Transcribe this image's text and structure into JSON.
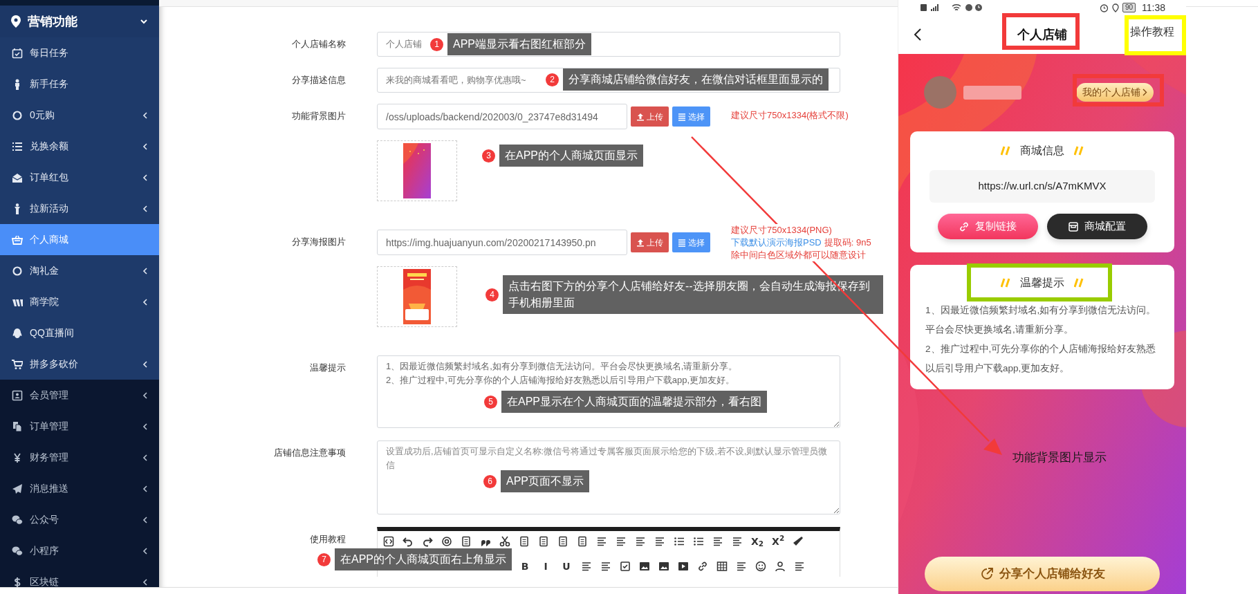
{
  "sidebar": {
    "header": {
      "label": "营销功能",
      "expanded": true
    },
    "items": [
      {
        "label": "每日任务",
        "nested": true,
        "has_submenu": false,
        "selected": false
      },
      {
        "label": "新手任务",
        "nested": true,
        "has_submenu": false,
        "selected": false
      },
      {
        "label": "0元购",
        "nested": true,
        "has_submenu": true,
        "selected": false
      },
      {
        "label": "兑换余额",
        "nested": true,
        "has_submenu": true,
        "selected": false
      },
      {
        "label": "订单红包",
        "nested": true,
        "has_submenu": true,
        "selected": false
      },
      {
        "label": "拉新活动",
        "nested": true,
        "has_submenu": true,
        "selected": false
      },
      {
        "label": "个人商城",
        "nested": true,
        "has_submenu": false,
        "selected": true
      },
      {
        "label": "淘礼金",
        "nested": true,
        "has_submenu": true,
        "selected": false
      },
      {
        "label": "商学院",
        "nested": true,
        "has_submenu": true,
        "selected": false
      },
      {
        "label": "QQ直播间",
        "nested": true,
        "has_submenu": false,
        "selected": false
      },
      {
        "label": "拼多多砍价",
        "nested": true,
        "has_submenu": true,
        "selected": false
      },
      {
        "label": "会员管理",
        "nested": false,
        "has_submenu": true,
        "selected": false
      },
      {
        "label": "订单管理",
        "nested": false,
        "has_submenu": true,
        "selected": false
      },
      {
        "label": "财务管理",
        "nested": false,
        "has_submenu": true,
        "selected": false
      },
      {
        "label": "消息推送",
        "nested": false,
        "has_submenu": true,
        "selected": false
      },
      {
        "label": "公众号",
        "nested": false,
        "has_submenu": true,
        "selected": false
      },
      {
        "label": "小程序",
        "nested": false,
        "has_submenu": true,
        "selected": false
      },
      {
        "label": "区块链",
        "nested": false,
        "has_submenu": true,
        "selected": false
      }
    ]
  },
  "form": {
    "rows": [
      {
        "kind": "input",
        "label": "个人店铺名称",
        "value": "个人店铺",
        "callout": {
          "number": "1",
          "text": "APP端显示看右图红框部分"
        }
      },
      {
        "kind": "input",
        "label": "分享描述信息",
        "value": "来我的商城看看吧，购物享优惠哦~",
        "callout": {
          "number": "2",
          "text": "分享商城店铺给微信好友，在微信对话框里面显示的"
        }
      },
      {
        "kind": "upload",
        "label": "功能背景图片",
        "value": "/oss/uploads/backend/202003/0_23747e8d31494",
        "buttons": [
          "上传",
          "选择"
        ],
        "hints": [
          {
            "kind": "warning",
            "text": "建议尺寸750x1334(格式不限)"
          }
        ],
        "callout": {
          "number": "3",
          "text": "在APP的个人商城页面显示"
        }
      },
      {
        "kind": "upload",
        "label": "分享海报图片",
        "value": "https://img.huajuanyun.com/20200217143950.pn",
        "buttons": [
          "上传",
          "选择"
        ],
        "hints": [
          {
            "kind": "warning",
            "text": "建议尺寸750x1334(PNG)"
          },
          {
            "kind": "link",
            "link": "下载默认演示海报PSD",
            "text": "提取码: 9n5"
          },
          {
            "kind": "warning",
            "text": "除中间白色区域外都可以随意设计"
          }
        ],
        "callout": {
          "number": "4",
          "text": "点击右图下方的分享个人店铺给好友--选择朋友圈，会自动生成海报保存到手机相册里面"
        }
      },
      {
        "kind": "textarea",
        "label": "温馨提示",
        "value": "1、因最近微信频繁封域名,如有分享到微信无法访问。平台会尽快更换域名,请重新分享。\n2、推广过程中,可先分享你的个人店铺海报给好友熟悉以后引导用户下载app,更加友好。",
        "callout": {
          "number": "5",
          "text": "在APP显示在个人商城页面的温馨提示部分，看右图"
        }
      },
      {
        "kind": "textarea",
        "label": "店铺信息注意事项",
        "placeholder": "设置成功后,店铺首页可显示自定义名称:微信号将通过专属客服页面展示给您的下级,若不设,则默认显示管理员微信",
        "callout": {
          "number": "6",
          "text": "APP页面不显示"
        }
      },
      {
        "kind": "editor",
        "label": "使用教程",
        "toolbar_texts": [
          [
            "X$_{2}$",
            "X$^{2}$"
          ],
          [
            "B",
            "I",
            "U"
          ]
        ],
        "callout": {
          "number": "7",
          "text": "在APP的个人商城页面右上角显示"
        }
      }
    ]
  },
  "phone": {
    "status": {
      "battery": "90",
      "time": "11:38"
    },
    "title": "个人店铺",
    "tutorial_link": "操作教程",
    "shop_button": "我的个人店铺",
    "info_card": {
      "title": "商城信息",
      "url": "https://w.url.cn/s/A7mKMVX",
      "buttons": [
        "复制链接",
        "商城配置"
      ]
    },
    "tips_card": {
      "title": "温馨提示",
      "lines": [
        "1、因最近微信频繁封域名,如有分享到微信无法访问。平台会尽快更换域名,请重新分享。",
        "2、推广过程中,可先分享你的个人店铺海报给好友熟悉以后引导用户下载app,更加友好。"
      ]
    },
    "caption": "功能背景图片显示",
    "share_button": "分享个人店铺给好友",
    "highlights": [
      {
        "color": "#f23a3a"
      },
      {
        "color": "#ffff00"
      },
      {
        "color": "#f23a3a"
      },
      {
        "color": "#99cc00"
      }
    ]
  }
}
